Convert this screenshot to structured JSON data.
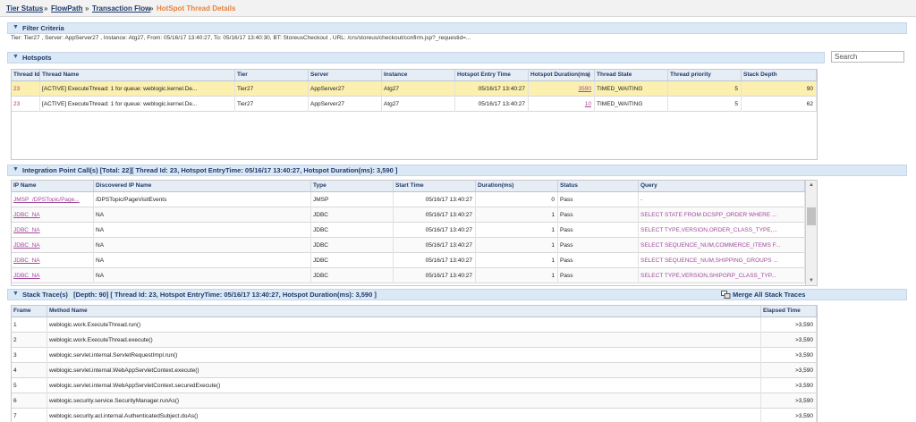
{
  "breadcrumb": {
    "items": [
      "Tier Status",
      "FlowPath",
      "Transaction Flow",
      "HotSpot Thread Details"
    ]
  },
  "filter": {
    "title": "Filter Criteria",
    "text": "Tier: Tier27 , Server: AppServer27 , Instance: Atg27, From: 05/16/17 13:40:27, To: 05/16/17 13:40:30, BT: StoreusCheckout , URL: /crs/storeus/checkout/confirm.jsp?_requestid=..."
  },
  "hotspots": {
    "title": "Hotspots",
    "search_placeholder": "Search",
    "columns": [
      "Thread Id",
      "Thread Name",
      "Tier",
      "Server",
      "Instance",
      "Hotspot Entry Time",
      "Hotspot Duration(ms)",
      "Thread State",
      "Thread priority",
      "Stack Depth"
    ],
    "sort_indicator": "▼",
    "rows": [
      {
        "thread_id": "23",
        "thread_name": "[ACTIVE] ExecuteThread: 1 for queue: weblogic.kernel.De...",
        "tier": "Tier27",
        "server": "AppServer27",
        "instance": "Atg27",
        "entry_time": "05/16/17 13:40:27",
        "duration": "3590",
        "state": "TIMED_WAITING",
        "priority": "5",
        "depth": "90",
        "selected": true
      },
      {
        "thread_id": "23",
        "thread_name": "[ACTIVE] ExecuteThread: 1 for queue: weblogic.kernel.De...",
        "tier": "Tier27",
        "server": "AppServer27",
        "instance": "Atg27",
        "entry_time": "05/16/17 13:40:27",
        "duration": "10",
        "state": "TIMED_WAITING",
        "priority": "5",
        "depth": "62",
        "selected": false
      }
    ]
  },
  "integration": {
    "title": "Integration Point Call(s)",
    "summary": "[Total: 22][ Thread Id: 23, Hotspot EntryTime: 05/16/17 13:40:27, Hotspot Duration(ms): 3,590 ]",
    "columns": [
      "IP Name",
      "Discovered IP Name",
      "Type",
      "Start Time",
      "Duration(ms)",
      "Status",
      "Query"
    ],
    "rows": [
      {
        "ip_name": "JMSP_/DPSTopic/Page...",
        "discovered": "/DPSTopic/PageVisitEvents",
        "type": "JMSP",
        "start": "05/16/17 13:40:27",
        "duration": "0",
        "status": "Pass",
        "query": "-"
      },
      {
        "ip_name": "JDBC_NA",
        "discovered": "NA",
        "type": "JDBC",
        "start": "05/16/17 13:40:27",
        "duration": "1",
        "status": "Pass",
        "query": "SELECT STATE FROM DCSPP_ORDER WHERE ..."
      },
      {
        "ip_name": "JDBC_NA",
        "discovered": "NA",
        "type": "JDBC",
        "start": "05/16/17 13:40:27",
        "duration": "1",
        "status": "Pass",
        "query": "SELECT TYPE,VERSION,ORDER_CLASS_TYPE,..."
      },
      {
        "ip_name": "JDBC_NA",
        "discovered": "NA",
        "type": "JDBC",
        "start": "05/16/17 13:40:27",
        "duration": "1",
        "status": "Pass",
        "query": "SELECT SEQUENCE_NUM,COMMERCE_ITEMS F..."
      },
      {
        "ip_name": "JDBC_NA",
        "discovered": "NA",
        "type": "JDBC",
        "start": "05/16/17 13:40:27",
        "duration": "1",
        "status": "Pass",
        "query": "SELECT SEQUENCE_NUM,SHIPPING_GROUPS ..."
      },
      {
        "ip_name": "JDBC_NA",
        "discovered": "NA",
        "type": "JDBC",
        "start": "05/16/17 13:40:27",
        "duration": "1",
        "status": "Pass",
        "query": "SELECT TYPE,VERSION,SHIPGRP_CLASS_TYP..."
      }
    ]
  },
  "stack": {
    "title": "Stack Trace(s)",
    "summary": "[Depth: 90] [ Thread Id: 23, Hotspot EntryTime: 05/16/17 13:40:27, Hotspot Duration(ms): 3,590 ]",
    "merge_label": "Merge All Stack Traces",
    "columns": [
      "Frame",
      "Method Name",
      "Elapsed Time"
    ],
    "rows": [
      {
        "frame": "1",
        "method": "weblogic.work.ExecuteThread.run()",
        "elapsed": ">3,590"
      },
      {
        "frame": "2",
        "method": "weblogic.work.ExecuteThread.execute()",
        "elapsed": ">3,590"
      },
      {
        "frame": "3",
        "method": "weblogic.servlet.internal.ServletRequestImpl.run()",
        "elapsed": ">3,590"
      },
      {
        "frame": "4",
        "method": "weblogic.servlet.internal.WebAppServletContext.execute()",
        "elapsed": ">3,590"
      },
      {
        "frame": "5",
        "method": "weblogic.servlet.internal.WebAppServletContext.securedExecute()",
        "elapsed": ">3,590"
      },
      {
        "frame": "6",
        "method": "weblogic.security.service.SecurityManager.runAs()",
        "elapsed": ">3,590"
      },
      {
        "frame": "7",
        "method": "weblogic.security.acl.internal.AuthenticatedSubject.doAs()",
        "elapsed": ">3,590"
      }
    ]
  },
  "colors": {
    "selected_row": "#fbf0b0",
    "header_bg": "#dbe8f5",
    "accent": "#e8833a",
    "link": "#a24a9c"
  }
}
